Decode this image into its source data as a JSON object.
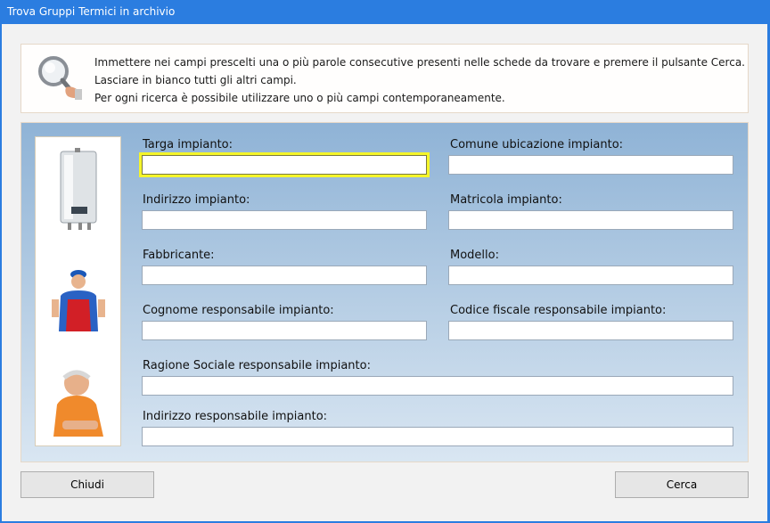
{
  "window": {
    "title": "Trova Gruppi Termici in archivio"
  },
  "info": {
    "line1": "Immettere nei campi prescelti una o più parole consecutive presenti nelle schede da trovare e premere il pulsante Cerca.",
    "line2": "Lasciare in bianco tutti gli altri campi.",
    "line3": "Per ogni ricerca è possibile utilizzare uno o più campi contemporaneamente."
  },
  "form": {
    "targa_label": "Targa impianto:",
    "comune_label": "Comune ubicazione impianto:",
    "indirizzo_label": "Indirizzo impianto:",
    "matricola_label": "Matricola impianto:",
    "fabbricante_label": "Fabbricante:",
    "modello_label": "Modello:",
    "cognome_label": "Cognome responsabile impianto:",
    "codice_label": "Codice fiscale responsabile impianto:",
    "ragione_label": "Ragione Sociale responsabile impianto:",
    "indirizzo_resp_label": "Indirizzo responsabile impianto:",
    "targa_value": "",
    "comune_value": "",
    "indirizzo_value": "",
    "matricola_value": "",
    "fabbricante_value": "",
    "modello_value": "",
    "cognome_value": "",
    "codice_value": "",
    "ragione_value": "",
    "indirizzo_resp_value": ""
  },
  "buttons": {
    "close": "Chiudi",
    "search": "Cerca"
  },
  "colors": {
    "titlebar": "#2b7de0",
    "focus_border": "#f5f52a"
  }
}
